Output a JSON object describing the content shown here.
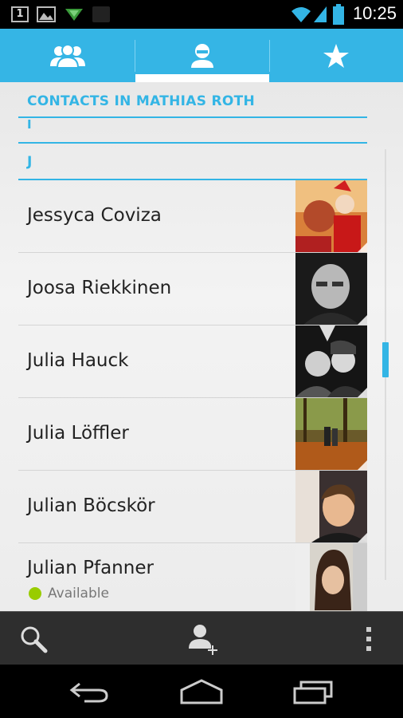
{
  "status": {
    "time": "10:25",
    "notification_count": "1"
  },
  "tabs": [
    {
      "name": "groups",
      "icon": "groups-icon"
    },
    {
      "name": "all-contacts",
      "icon": "person-icon",
      "selected": true
    },
    {
      "name": "favorites",
      "icon": "star-icon"
    }
  ],
  "account_header": "CONTACTS IN MATHIAS ROTH",
  "sections": [
    {
      "letter": "I"
    },
    {
      "letter": "J"
    }
  ],
  "contacts": [
    {
      "name": "Jessyca Coviza"
    },
    {
      "name": "Joosa Riekkinen"
    },
    {
      "name": "Julia Hauck"
    },
    {
      "name": "Julia Löffler"
    },
    {
      "name": "Julian Böcskör"
    },
    {
      "name": "Julian Pfanner",
      "status": "Available"
    }
  ],
  "actions": [
    "search-icon",
    "add-contact-icon",
    "overflow-menu-icon"
  ],
  "colors": {
    "accent": "#33b5e5",
    "tabbar": "#35b5e5",
    "presence": "#99cc00"
  }
}
